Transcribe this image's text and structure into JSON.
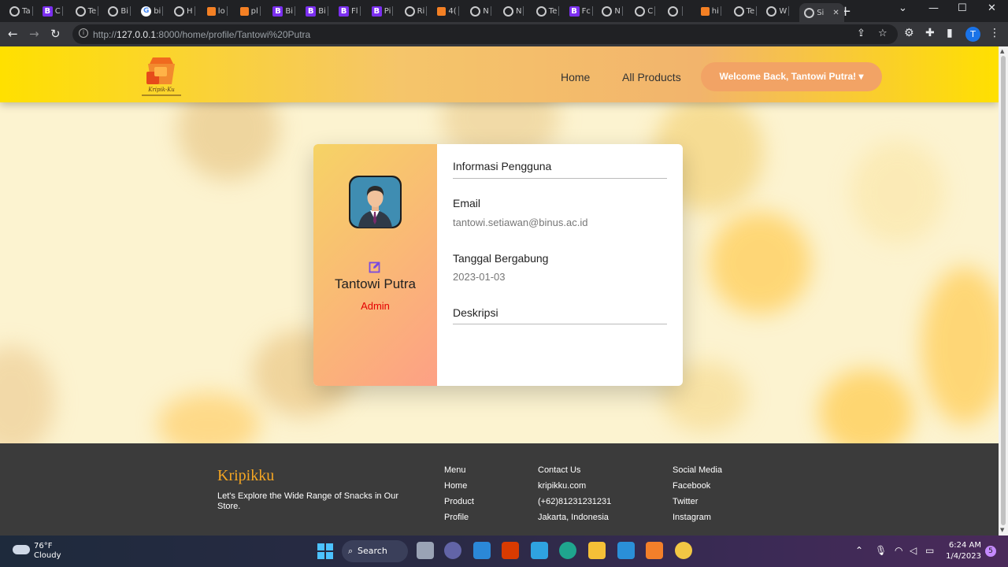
{
  "browser": {
    "tabs": [
      {
        "label": "Ta",
        "icon": "globe-icon"
      },
      {
        "label": "C",
        "icon": "bootstrap-icon"
      },
      {
        "label": "Te",
        "icon": "globe-icon"
      },
      {
        "label": "Bi",
        "icon": "mdb-icon"
      },
      {
        "label": "bi",
        "icon": "google-icon"
      },
      {
        "label": "H",
        "icon": "globe-icon"
      },
      {
        "label": "lo",
        "icon": "laravel-icon"
      },
      {
        "label": "pl",
        "icon": "stackoverflow-icon"
      },
      {
        "label": "Bi",
        "icon": "bootstrap-icon"
      },
      {
        "label": "Bi",
        "icon": "bootstrap-icon"
      },
      {
        "label": "Fl",
        "icon": "bootstrap-icon"
      },
      {
        "label": "Pi",
        "icon": "bootstrap-icon"
      },
      {
        "label": "Ri",
        "icon": "layers-icon"
      },
      {
        "label": "4(",
        "icon": "stackoverflow-icon"
      },
      {
        "label": "N",
        "icon": "globe-icon"
      },
      {
        "label": "N",
        "icon": "globe-icon"
      },
      {
        "label": "Te",
        "icon": "globe-icon"
      },
      {
        "label": "Fc",
        "icon": "bootstrap-icon"
      },
      {
        "label": "N",
        "icon": "github-icon"
      },
      {
        "label": "C",
        "icon": "refresh-icon"
      },
      {
        "label": "",
        "icon": "globe-icon"
      },
      {
        "label": "hi",
        "icon": "stackoverflow-icon"
      },
      {
        "label": "Te",
        "icon": "globe-icon"
      },
      {
        "label": "W",
        "icon": "rocket-icon"
      },
      {
        "label": "Si",
        "icon": "globe-icon"
      }
    ],
    "url_host": "127.0.0.1",
    "url_rest": ":8000/home/profile/Tantowi%20Putra",
    "url_prefix": "http://",
    "profile_initial": "T"
  },
  "site": {
    "logo_text": "Kripik-Ku",
    "nav": {
      "home": "Home",
      "all_products": "All Products",
      "welcome": "Welcome Back, Tantowi Putra! ▾"
    }
  },
  "profile": {
    "name": "Tantowi Putra",
    "role": "Admin",
    "section_title": "Informasi Pengguna",
    "email_label": "Email",
    "email_value": "tantowi.setiawan@binus.ac.id",
    "joined_label": "Tanggal Bergabung",
    "joined_value": "2023-01-03",
    "desc_label": "Deskripsi"
  },
  "footer": {
    "brand": "Kripikku",
    "tagline": "Let's Explore the Wide Range of Snacks in Our Store.",
    "menu": {
      "title": "Menu",
      "items": [
        "Home",
        "Product",
        "Profile"
      ]
    },
    "contact": {
      "title": "Contact Us",
      "items": [
        "kripikku.com",
        "(+62)81231231231",
        "Jakarta, Indonesia"
      ]
    },
    "social": {
      "title": "Social Media",
      "items": [
        "Facebook",
        "Twitter",
        "Instagram"
      ]
    }
  },
  "taskbar": {
    "temp": "76°F",
    "weather": "Cloudy",
    "search": "Search",
    "time": "6:24 AM",
    "date": "1/4/2023",
    "notifications": "5"
  },
  "colors": {
    "nav_gradient": [
      "#ffe000",
      "#f2b46c"
    ],
    "welcome_button": "#f2a365",
    "role": "#e40000",
    "footer_brand": "#f5a623",
    "footer_bg": "#3b3b3b"
  }
}
